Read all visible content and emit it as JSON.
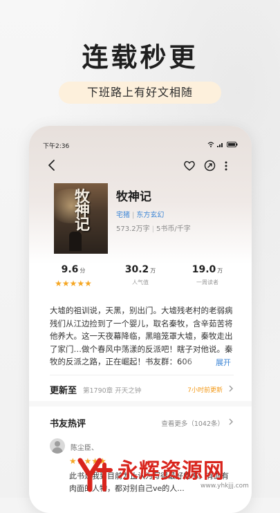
{
  "promo": {
    "headline": "连载秒更",
    "subtitle": "下班路上有好文相随"
  },
  "status_bar": {
    "time": "下午2:36"
  },
  "book": {
    "cover_text": "牧神记",
    "title": "牧神记",
    "author": "宅猪",
    "genre": "东方玄幻",
    "word_count": "573.2万字",
    "price": "5书币/千字"
  },
  "stats": [
    {
      "value": "9.6",
      "unit": "分",
      "label": "",
      "stars": "★★★★★"
    },
    {
      "value": "30.2",
      "unit": "万",
      "label": "人气值"
    },
    {
      "value": "19.0",
      "unit": "万",
      "label": "一周读者"
    }
  ],
  "description": "大墟的祖训说，天黑，别出门。大墟残老村的老弱病残们从江边捡到了一个婴儿，取名秦牧，含辛茹苦将他养大。这一天夜幕降临，黑暗笼罩大墟，秦牧走出了家门…做个春风中荡漾的反派吧！瞎子对他说。秦牧的反派之路，正在崛起！书友群：606",
  "expand_label": "展开",
  "updates": {
    "heading": "更新至",
    "chapter": "第1790章 开天之钟",
    "time_ago": "7小时前更新"
  },
  "reviews": {
    "heading": "书友热评",
    "more": "查看更多（1042条）",
    "items": [
      {
        "name": "陈尘臣、",
        "stars": "★★★★★",
        "text": "此书是我到目前为止认为写得最好的书。有血有肉面的人物，都对别自己ve的人..."
      }
    ]
  },
  "watermark": {
    "text": "永辉资源网",
    "url": "www.yhkjjj.com"
  },
  "colors": {
    "accent_blue": "#3e86d6",
    "star": "#f5a623",
    "update_orange": "#f39a1a",
    "watermark_red": "#d9241c",
    "pill_bg": "#fdf0dc"
  }
}
